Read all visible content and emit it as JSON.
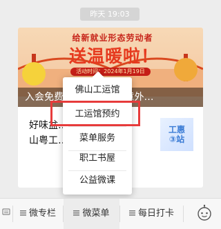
{
  "chat": {
    "timestamp": "昨天  19:03"
  },
  "article_card": {
    "banner": {
      "top_text": "给新就业形态劳动者",
      "main_text": "送温暖啦！",
      "date_text": "活动时间：2024年1月19日",
      "caption": "入会免费送…              加送一年意外…"
    },
    "body_title_line1": "好味盆…                    天手佛",
    "body_title_line2": "山粤工…                    福利）",
    "thumb_text": "工惠\n③站"
  },
  "popup_menu": {
    "items": [
      {
        "label": "佛山工运馆"
      },
      {
        "label": "工运馆预约"
      },
      {
        "label": "菜单服务"
      },
      {
        "label": "职工书屋"
      },
      {
        "label": "公益微课"
      }
    ],
    "highlighted_index": 1,
    "highlight_color": "#e73b3b"
  },
  "menu_bar": {
    "tabs": [
      {
        "label": "微专栏"
      },
      {
        "label": "微菜单"
      },
      {
        "label": "每日打卡"
      }
    ],
    "active_index": 1,
    "keyboard_icon": "keyboard-toggle-icon",
    "service_icon": "robot-icon"
  }
}
